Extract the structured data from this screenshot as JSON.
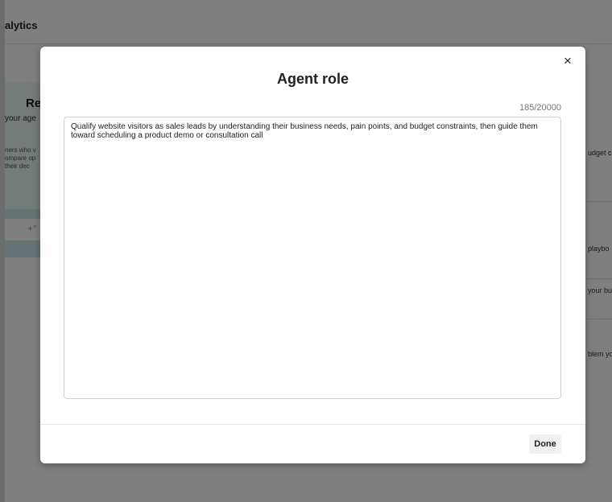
{
  "background": {
    "header_title": "alytics",
    "card": {
      "title": "Re",
      "subtitle": "your age",
      "body_lines": "ners who v\nompare op\ntheir dec",
      "button_icon": "+°"
    },
    "right_column": [
      "udget co",
      "playbo",
      "your bus",
      "blem yo"
    ]
  },
  "modal": {
    "title": "Agent role",
    "counter": "185/20000",
    "textarea_value": "Qualify website visitors as sales leads by understanding their business needs, pain points, and budget constraints, then guide them toward scheduling a product demo or consultation call",
    "close_icon": "×",
    "done_label": "Done"
  }
}
